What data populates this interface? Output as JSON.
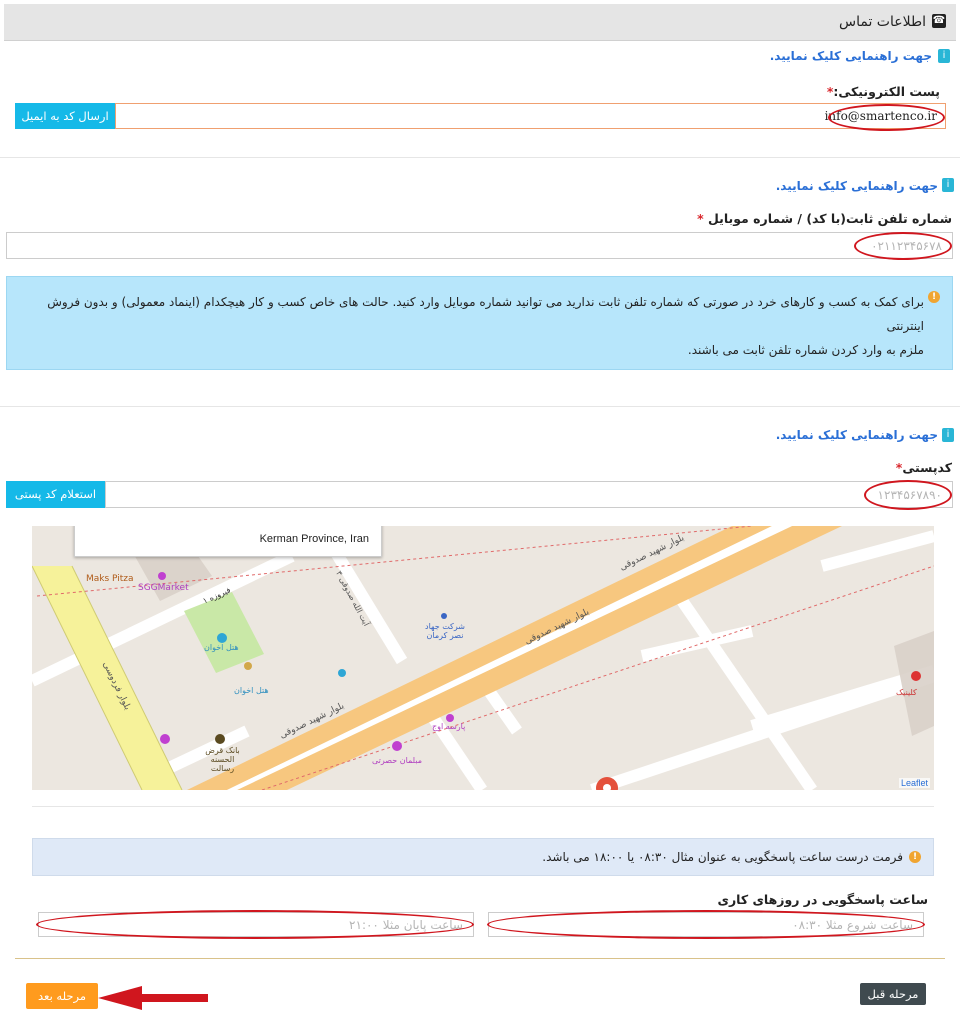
{
  "header": {
    "title": "اطلاعات تماس"
  },
  "email_section": {
    "help": "جهت راهنمایی کلیک نمایید.",
    "label": "پست الکترونیکی:",
    "required": "*",
    "value": "info@smartenco.ir",
    "button": "ارسال کد به ایمیل"
  },
  "phone_section": {
    "help": "جهت راهنمایی کلیک نمایید.",
    "label": "شماره تلفن ثابت(با کد) / شماره موبایل",
    "required": "*",
    "placeholder": "۰۲۱۱۲۳۴۵۶۷۸",
    "alert_line1": "برای کمک به کسب و کارهای خرد در صورتی که شماره تلفن ثابت ندارید می توانید شماره موبایل وارد کنید. حالت های خاص کسب و کار هیچکدام (اینماد معمولی) و بدون فروش اینترنتی",
    "alert_line2": "ملزم به وارد کردن شماره تلفن ثابت می باشند."
  },
  "postal_section": {
    "help": "جهت راهنمایی کلیک نمایید.",
    "label": "کدپستی",
    "required": "*",
    "placeholder": "۱۲۳۴۵۶۷۸۹۰",
    "button": "استعلام کد پستی"
  },
  "map": {
    "popup": "Kerman Province, Iran",
    "attribution": "Leaflet",
    "labels": {
      "maks": "Maks Pitza",
      "sgg": "SGGMarket",
      "firuze_street": "فیروزه ۱",
      "hotel1": "هتل اخوان",
      "hotel2": "هتل اخوان",
      "boulevard1": "بلوار شهید صدوقی",
      "boulevard2": "بلوار شهید صدوقی",
      "boulevard3": "بلوار شهید صدوقی",
      "ferdowsi": "بلوار فردوسی",
      "jahad": "شرکت جهاد نصر کرمان",
      "ayatollah": "آیت الله صدوقی ۳",
      "parseh": "پارسه اوج",
      "mobl": "مبلمان حصرتی",
      "bank": "بانک قرض الحسنه رسالت",
      "clinic": "کلینیک"
    }
  },
  "hours_section": {
    "alert": "فرمت درست ساعت پاسخگویی به عنوان مثال ۰۸:۳۰ یا ۱۸:۰۰ می باشد.",
    "label": "ساعت پاسخگویی در روزهای کاری",
    "start_placeholder": "ساعت شروع مثلا ۰۸:۳۰",
    "end_placeholder": "ساعت پایان مثلا ۲۱:۰۰"
  },
  "footer": {
    "next": "مرحله بعد",
    "prev": "مرحله قبل"
  },
  "colors": {
    "accent": "#15b9e8",
    "highlight": "#d0161e",
    "next_button": "#ff9b1e"
  }
}
